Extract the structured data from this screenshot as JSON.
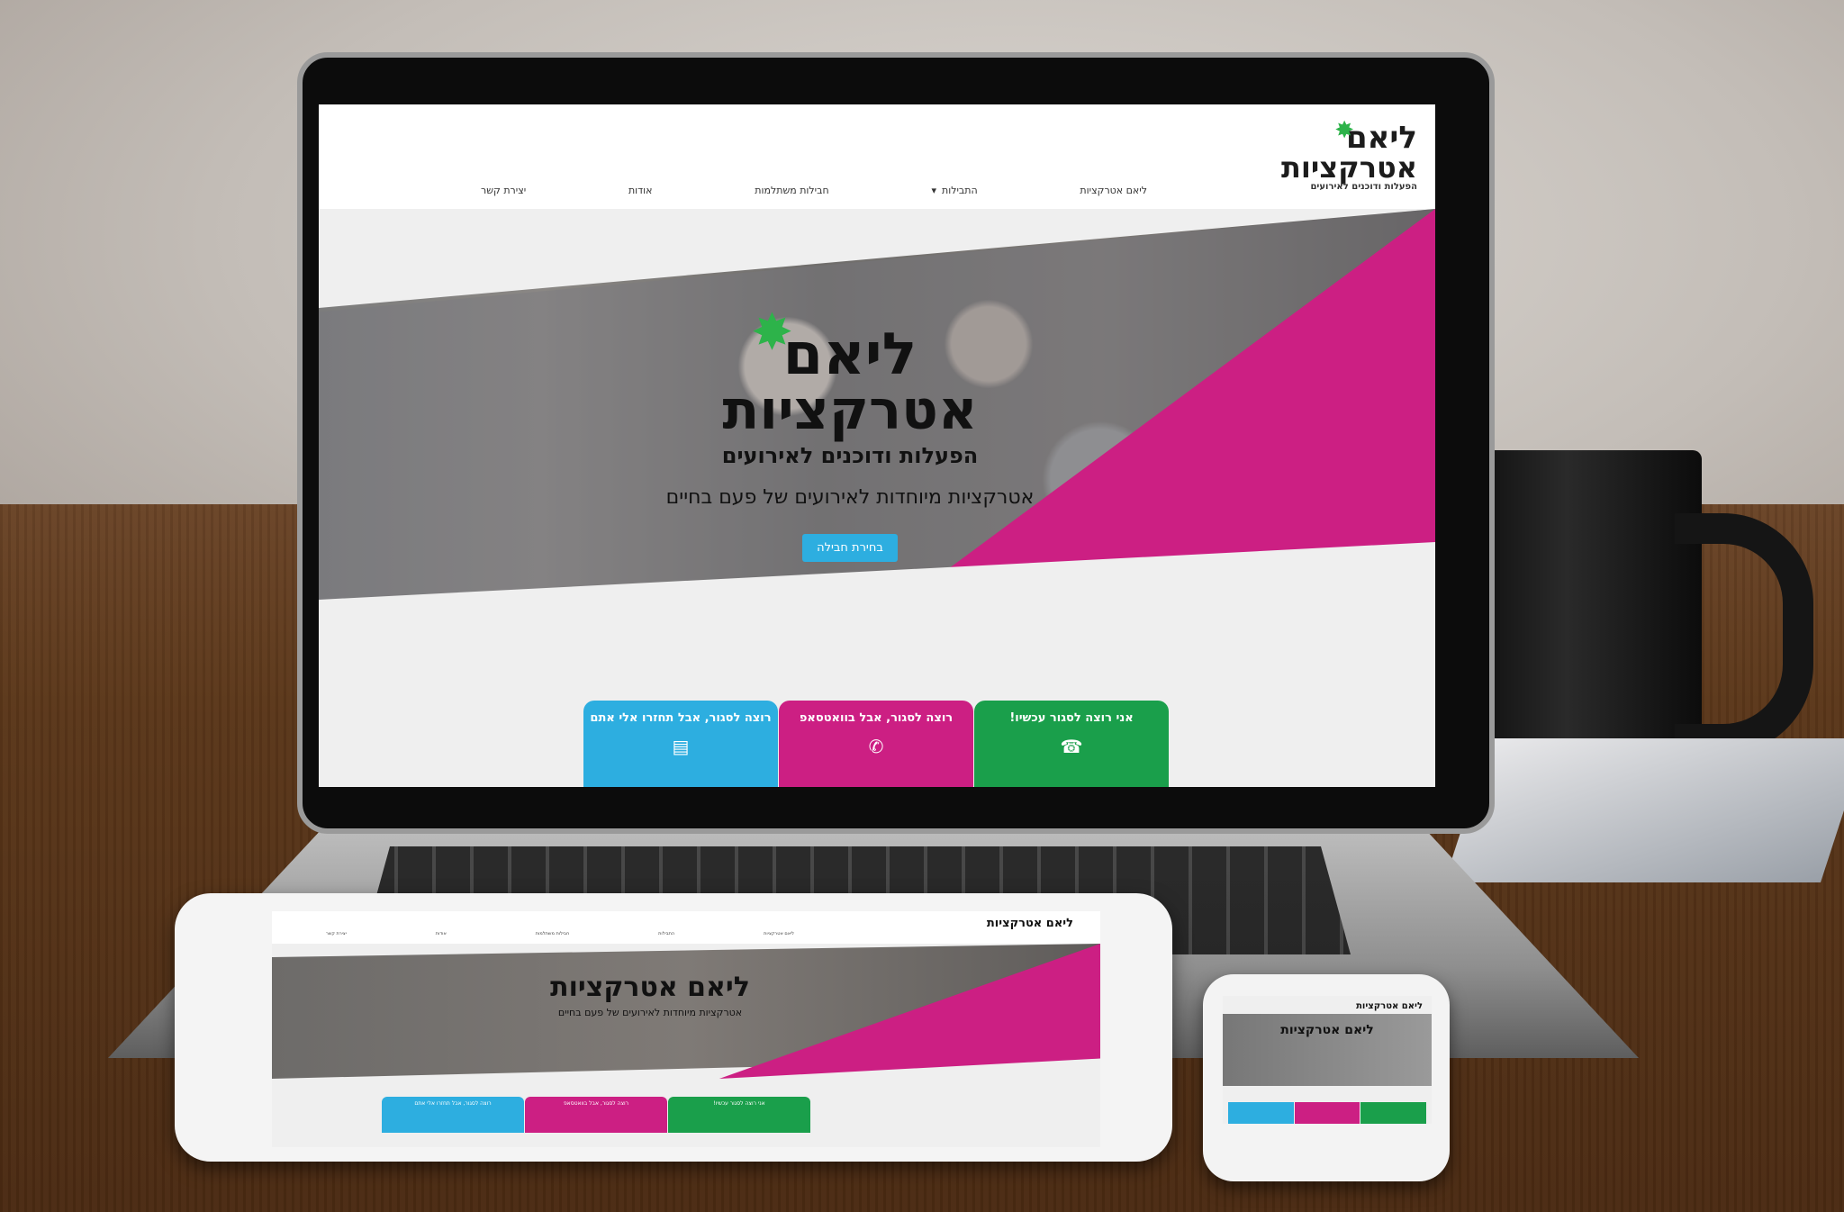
{
  "site": {
    "logo": {
      "line1": "ליאם",
      "line2": "אטרקציות",
      "tagline": "הפעלות ודוכנים לאירועים"
    },
    "nav": [
      "ליאם אטרקציות",
      "התבילות",
      "חבילות משתלמות",
      "אודות",
      "יצירת קשר"
    ],
    "hero": {
      "logo_line1": "ליאם",
      "logo_line2": "אטרקציות",
      "tagline": "הפעלות ודוכנים לאירועים",
      "subtitle": "אטרקציות מיוחדות לאירועים של פעם בחיים",
      "cta": "בחירת חבילה"
    },
    "ctas": [
      {
        "label": "רוצה לסגור, אבל תחזרו אלי אתם",
        "icon": "form-icon",
        "color": "#2daee0"
      },
      {
        "label": "רוצה לסגור, אבל בוואטסאפ",
        "icon": "whatsapp-icon",
        "color": "#cc1f83"
      },
      {
        "label": "אני רוצה לסגור עכשיו!",
        "icon": "phone-icon",
        "color": "#1a9f4b"
      }
    ],
    "colors": {
      "accent_blue": "#2daee0",
      "accent_magenta": "#cc1f83",
      "accent_green": "#1a9f4b"
    }
  },
  "tablet": {
    "logo": "ליאם אטרקציות",
    "subtitle": "אטרקציות מיוחדות לאירועים של פעם בחיים",
    "nav": [
      "ליאם אטרקציות",
      "התבילות",
      "חבילות משתלמות",
      "אודות",
      "יצירת קשר"
    ],
    "ctas": [
      "רוצה לסגור, אבל תחזרו אלי אתם",
      "רוצה לסגור, אבל בוואטסאפ",
      "אני רוצה לסגור עכשיו!"
    ]
  },
  "phone": {
    "logo": "ליאם אטרקציות",
    "hero": "ליאם אטרקציות"
  }
}
